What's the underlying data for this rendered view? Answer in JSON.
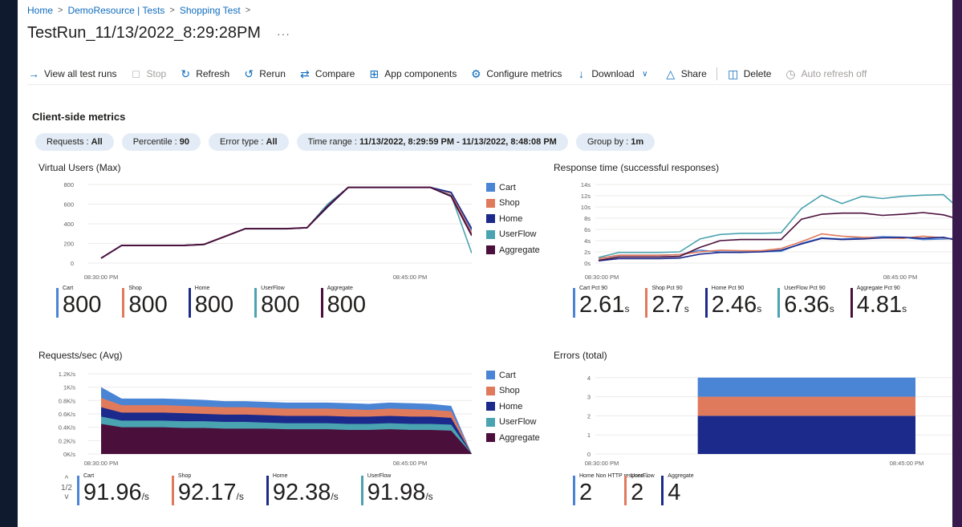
{
  "breadcrumb": [
    "Home",
    "DemoResource | Tests",
    "Shopping Test"
  ],
  "title": "TestRun_11/13/2022_8:29:28PM",
  "more": "···",
  "toolbar": {
    "view_all": "View all test runs",
    "stop": "Stop",
    "refresh": "Refresh",
    "rerun": "Rerun",
    "compare": "Compare",
    "app_components": "App components",
    "configure_metrics": "Configure metrics",
    "download": "Download",
    "share": "Share",
    "delete": "Delete",
    "auto_refresh": "Auto refresh off"
  },
  "section_title": "Client-side metrics",
  "filters": [
    {
      "label": "Requests : ",
      "value": "All"
    },
    {
      "label": "Percentile : ",
      "value": "90"
    },
    {
      "label": "Error type : ",
      "value": "All"
    },
    {
      "label": "Time range : ",
      "value": "11/13/2022, 8:29:59 PM - 11/13/2022, 8:48:08 PM"
    },
    {
      "label": "Group by : ",
      "value": "1m"
    }
  ],
  "colors": {
    "Cart": "#4a84d4",
    "Shop": "#e07a5c",
    "Home": "#1c2a8c",
    "UserFlow": "#4aa3b0",
    "Aggregate": "#4b0f3c"
  },
  "panels": {
    "vu": {
      "title": "Virtual Users (Max)",
      "legend": [
        "Cart",
        "Shop",
        "Home",
        "UserFlow",
        "Aggregate"
      ],
      "stats": [
        {
          "label": "Cart",
          "value": "800",
          "unit": ""
        },
        {
          "label": "Shop",
          "value": "800",
          "unit": ""
        },
        {
          "label": "Home",
          "value": "800",
          "unit": ""
        },
        {
          "label": "UserFlow",
          "value": "800",
          "unit": ""
        },
        {
          "label": "Aggregate",
          "value": "800",
          "unit": ""
        }
      ]
    },
    "rt": {
      "title": "Response time (successful responses)",
      "stats": [
        {
          "label": "Cart Pct 90",
          "value": "2.61",
          "unit": "s"
        },
        {
          "label": "Shop Pct 90",
          "value": "2.7",
          "unit": "s"
        },
        {
          "label": "Home Pct 90",
          "value": "2.46",
          "unit": "s"
        },
        {
          "label": "UserFlow Pct 90",
          "value": "6.36",
          "unit": "s"
        },
        {
          "label": "Aggregate Pct 90",
          "value": "4.81",
          "unit": "s"
        }
      ]
    },
    "rps": {
      "title": "Requests/sec (Avg)",
      "legend": [
        "Cart",
        "Shop",
        "Home",
        "UserFlow",
        "Aggregate"
      ],
      "pager": {
        "up": "^",
        "page": "1/2",
        "down": "v"
      },
      "stats": [
        {
          "label": "Cart",
          "value": "91.96",
          "unit": "/s"
        },
        {
          "label": "Shop",
          "value": "92.17",
          "unit": "/s"
        },
        {
          "label": "Home",
          "value": "92.38",
          "unit": "/s"
        },
        {
          "label": "UserFlow",
          "value": "91.98",
          "unit": "/s"
        }
      ]
    },
    "err": {
      "title": "Errors (total)",
      "stats": [
        {
          "label": "Home Non HTTP respons...",
          "value": "2",
          "unit": "",
          "color": "#4a84d4"
        },
        {
          "label": "UserFlow",
          "value": "2",
          "unit": "",
          "color": "#e07a5c"
        },
        {
          "label": "Aggregate",
          "value": "4",
          "unit": "",
          "color": "#1c2a8c"
        }
      ]
    }
  },
  "chart_data": [
    {
      "type": "line",
      "title": "Virtual Users (Max)",
      "x_ticks": [
        "08:30:00 PM",
        "08:45:00 PM"
      ],
      "y_ticks": [
        "0",
        "200",
        "400",
        "600",
        "800"
      ],
      "ylim": [
        0,
        850
      ],
      "x_minutes": [
        0,
        1,
        2,
        3,
        4,
        5,
        6,
        7,
        8,
        9,
        10,
        11,
        12,
        13,
        14,
        15,
        16,
        17,
        18
      ],
      "series": [
        {
          "name": "Cart",
          "values": [
            50,
            180,
            180,
            180,
            180,
            190,
            270,
            350,
            350,
            350,
            360,
            570,
            770,
            770,
            770,
            770,
            770,
            720,
            330
          ]
        },
        {
          "name": "Shop",
          "values": [
            50,
            180,
            180,
            180,
            180,
            190,
            270,
            350,
            350,
            350,
            360,
            570,
            770,
            770,
            770,
            770,
            770,
            710,
            300
          ]
        },
        {
          "name": "Home",
          "values": [
            50,
            180,
            180,
            180,
            180,
            190,
            270,
            350,
            350,
            350,
            360,
            570,
            770,
            770,
            770,
            770,
            770,
            720,
            350
          ]
        },
        {
          "name": "UserFlow",
          "values": [
            50,
            180,
            180,
            180,
            180,
            190,
            270,
            350,
            350,
            350,
            360,
            600,
            770,
            770,
            770,
            770,
            770,
            690,
            100
          ]
        },
        {
          "name": "Aggregate",
          "values": [
            50,
            180,
            180,
            180,
            180,
            190,
            270,
            350,
            350,
            350,
            360,
            580,
            770,
            770,
            770,
            770,
            770,
            680,
            280
          ]
        }
      ]
    },
    {
      "type": "line",
      "title": "Response time (successful responses)",
      "x_ticks": [
        "08:30:00 PM",
        "08:45:00 PM"
      ],
      "y_ticks": [
        "0s",
        "2s",
        "4s",
        "6s",
        "8s",
        "10s",
        "12s",
        "14s"
      ],
      "ylim": [
        0,
        14
      ],
      "x_minutes": [
        0,
        1,
        2,
        3,
        4,
        5,
        6,
        7,
        8,
        9,
        10,
        11,
        12,
        13,
        14,
        15,
        16,
        17,
        18
      ],
      "series": [
        {
          "name": "Cart",
          "values": [
            0.8,
            1.4,
            1.4,
            1.4,
            1.5,
            2.3,
            2.0,
            2.0,
            2.0,
            2.1,
            3.5,
            4.5,
            4.3,
            4.5,
            4.7,
            4.6,
            4.2,
            4.3,
            4.5
          ]
        },
        {
          "name": "Shop",
          "values": [
            0.8,
            1.4,
            1.4,
            1.4,
            1.5,
            2.0,
            2.3,
            2.2,
            2.2,
            2.6,
            3.8,
            5.2,
            4.8,
            4.6,
            4.5,
            4.4,
            4.8,
            4.5,
            4.0
          ]
        },
        {
          "name": "Home",
          "values": [
            0.4,
            0.8,
            0.8,
            0.8,
            0.9,
            1.6,
            1.9,
            1.9,
            2.0,
            2.3,
            3.4,
            4.4,
            4.2,
            4.3,
            4.5,
            4.6,
            4.4,
            4.6,
            3.8
          ]
        },
        {
          "name": "UserFlow",
          "values": [
            1.0,
            1.9,
            1.9,
            1.9,
            2.0,
            4.3,
            5.1,
            5.3,
            5.3,
            5.4,
            9.7,
            12.1,
            10.6,
            11.9,
            11.5,
            11.9,
            12.1,
            12.2,
            9.0
          ]
        },
        {
          "name": "Aggregate",
          "values": [
            0.5,
            1.1,
            1.1,
            1.1,
            1.2,
            2.8,
            4.0,
            4.2,
            4.2,
            4.2,
            7.8,
            8.7,
            8.9,
            8.9,
            8.5,
            8.7,
            9.0,
            8.6,
            7.6
          ]
        }
      ]
    },
    {
      "type": "area",
      "title": "Requests/sec (Avg)",
      "x_ticks": [
        "08:30:00 PM",
        "08:45:00 PM"
      ],
      "y_ticks": [
        "0K/s",
        "0.2K/s",
        "0.4K/s",
        "0.6K/s",
        "0.8K/s",
        "1K/s",
        "1.2K/s"
      ],
      "ylim": [
        0,
        1.2
      ],
      "stacked": true,
      "x_minutes": [
        0,
        1,
        2,
        3,
        4,
        5,
        6,
        7,
        8,
        9,
        10,
        11,
        12,
        13,
        14,
        15,
        16,
        17,
        18
      ],
      "series": [
        {
          "name": "Aggregate",
          "values": [
            0.45,
            0.4,
            0.4,
            0.4,
            0.39,
            0.39,
            0.38,
            0.38,
            0.38,
            0.37,
            0.37,
            0.37,
            0.36,
            0.36,
            0.37,
            0.36,
            0.36,
            0.35,
            0.0
          ]
        },
        {
          "name": "UserFlow",
          "values": [
            0.11,
            0.1,
            0.1,
            0.1,
            0.1,
            0.1,
            0.1,
            0.1,
            0.09,
            0.09,
            0.09,
            0.09,
            0.09,
            0.09,
            0.09,
            0.09,
            0.09,
            0.09,
            0.0
          ]
        },
        {
          "name": "Home",
          "values": [
            0.14,
            0.12,
            0.12,
            0.12,
            0.12,
            0.11,
            0.11,
            0.11,
            0.11,
            0.11,
            0.11,
            0.11,
            0.11,
            0.11,
            0.11,
            0.11,
            0.11,
            0.1,
            0.0
          ]
        },
        {
          "name": "Shop",
          "values": [
            0.14,
            0.11,
            0.11,
            0.11,
            0.11,
            0.11,
            0.11,
            0.11,
            0.11,
            0.11,
            0.11,
            0.11,
            0.11,
            0.1,
            0.11,
            0.11,
            0.1,
            0.1,
            0.0
          ]
        },
        {
          "name": "Cart",
          "values": [
            0.16,
            0.1,
            0.1,
            0.1,
            0.1,
            0.1,
            0.09,
            0.09,
            0.09,
            0.09,
            0.09,
            0.09,
            0.09,
            0.09,
            0.09,
            0.09,
            0.09,
            0.08,
            0.0
          ]
        }
      ]
    },
    {
      "type": "bar",
      "title": "Errors (total)",
      "x_ticks": [
        "08:30:00 PM",
        "08:45:00 PM"
      ],
      "y_ticks": [
        "0",
        "1",
        "2",
        "3",
        "4"
      ],
      "ylim": [
        0,
        4.2
      ],
      "stacked": true,
      "x_range_minutes": [
        6,
        18
      ],
      "series": [
        {
          "name": "Aggregate",
          "values": [
            2
          ]
        },
        {
          "name": "UserFlow",
          "values": [
            1
          ]
        },
        {
          "name": "Home Non HTTP respons...",
          "values": [
            1
          ]
        }
      ]
    }
  ]
}
